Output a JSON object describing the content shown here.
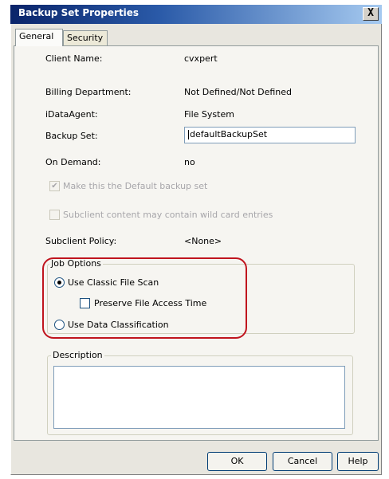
{
  "window": {
    "title": "Backup Set Properties",
    "close_label": "X",
    "accent": "#0a246a",
    "annotation_color": "#c0141e"
  },
  "tabs": [
    {
      "label": "General",
      "active": true
    },
    {
      "label": "Security",
      "active": false
    }
  ],
  "fields": {
    "client_name_label": "Client Name:",
    "client_name_value": "cvxpert",
    "billing_label": "Billing Department:",
    "billing_value": "Not Defined/Not Defined",
    "idataagent_label": "iDataAgent:",
    "idataagent_value": "File System",
    "backup_set_label": "Backup Set:",
    "backup_set_value": "defaultBackupSet",
    "on_demand_label": "On Demand:",
    "on_demand_value": "no",
    "default_backup_set_label": "Make this the Default backup set",
    "wildcard_label": "Subclient content may contain wild card entries",
    "subclient_policy_label": "Subclient Policy:",
    "subclient_policy_value": "<None>"
  },
  "job_options": {
    "label": "Job Options",
    "classic_scan_label": "Use Classic File Scan",
    "preserve_time_label": "Preserve File Access Time",
    "data_classification_label": "Use Data Classification",
    "classic_scan_selected": true,
    "preserve_time_checked": false
  },
  "description": {
    "label": "Description",
    "value": ""
  },
  "buttons": {
    "ok": "OK",
    "cancel": "Cancel",
    "help": "Help"
  }
}
